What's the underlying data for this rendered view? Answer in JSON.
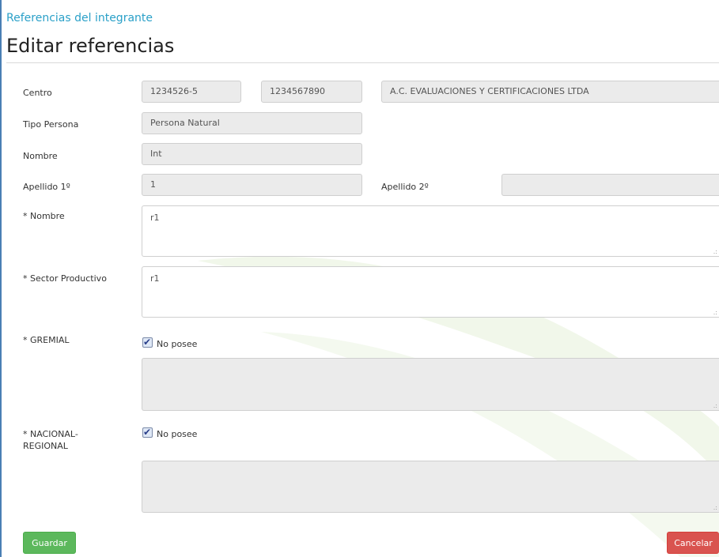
{
  "header": {
    "breadcrumb": "Referencias del integrante",
    "title": "Editar referencias"
  },
  "form": {
    "centro": {
      "label": "Centro",
      "code": "1234526-5",
      "number": "1234567890",
      "name": "A.C. EVALUACIONES Y CERTIFICACIONES LTDA"
    },
    "tipo_persona": {
      "label": "Tipo Persona",
      "value": "Persona Natural"
    },
    "nombre_integrante": {
      "label": "Nombre",
      "value": "Int"
    },
    "apellido1": {
      "label": "Apellido 1º",
      "value": "1"
    },
    "apellido2": {
      "label": "Apellido 2º",
      "value": ""
    },
    "nombre_ref": {
      "label": "* Nombre",
      "value": "r1"
    },
    "sector": {
      "label": "* Sector Productivo",
      "value": "r1"
    },
    "gremial": {
      "label": "* GREMIAL",
      "checkbox_label": "No posee",
      "checked": true,
      "value": ""
    },
    "nacional": {
      "label_line1": "* NACIONAL-",
      "label_line2": "REGIONAL",
      "checkbox_label": "No posee",
      "checked": true,
      "value": ""
    }
  },
  "actions": {
    "save": "Guardar",
    "cancel": "Cancelar"
  },
  "colors": {
    "accent": "#2aa0c8",
    "save": "#5cb85c",
    "cancel": "#d9534f"
  }
}
